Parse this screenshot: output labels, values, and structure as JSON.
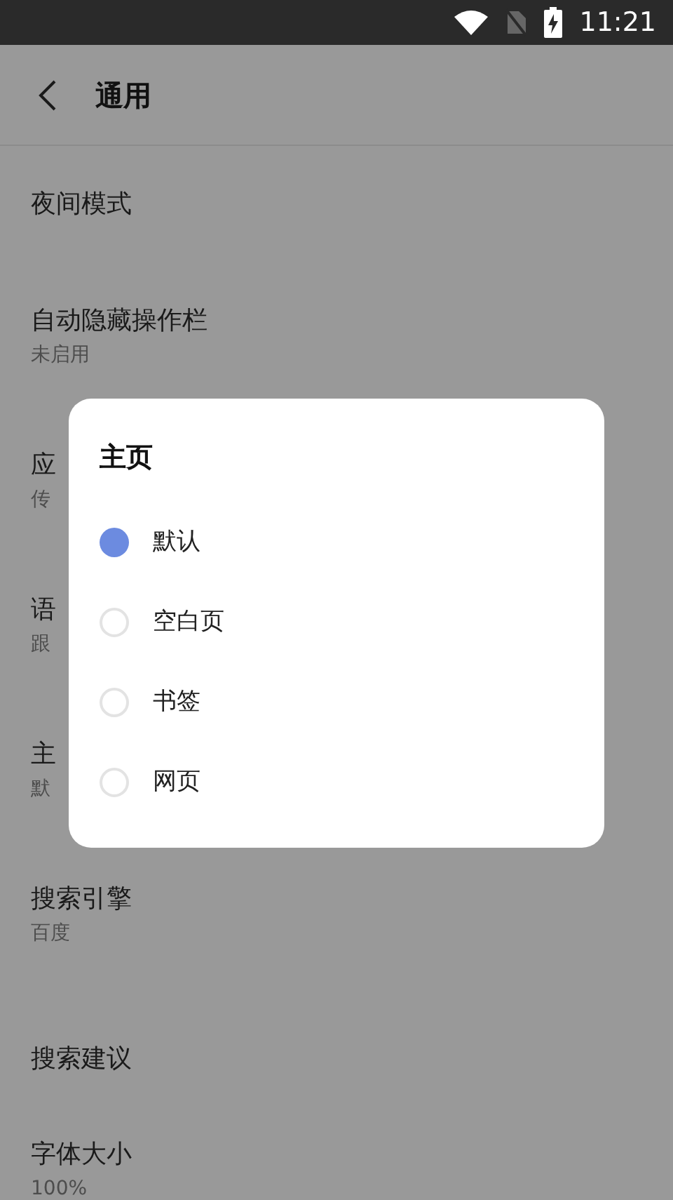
{
  "status_bar": {
    "time": "11:21"
  },
  "header": {
    "title": "通用"
  },
  "settings": [
    {
      "title": "夜间模式"
    },
    {
      "title": "自动隐藏操作栏",
      "subtitle": "未启用"
    },
    {
      "title": "应",
      "subtitle": "传"
    },
    {
      "title": "语",
      "subtitle": "跟"
    },
    {
      "title": "主",
      "subtitle": "默"
    },
    {
      "title": "搜索引擎",
      "subtitle": "百度"
    },
    {
      "title": "搜索建议"
    },
    {
      "title": "字体大小",
      "subtitle": "100%"
    }
  ],
  "dialog": {
    "title": "主页",
    "options": [
      {
        "label": "默认",
        "selected": true
      },
      {
        "label": "空白页",
        "selected": false
      },
      {
        "label": "书签",
        "selected": false
      },
      {
        "label": "网页",
        "selected": false
      }
    ]
  }
}
